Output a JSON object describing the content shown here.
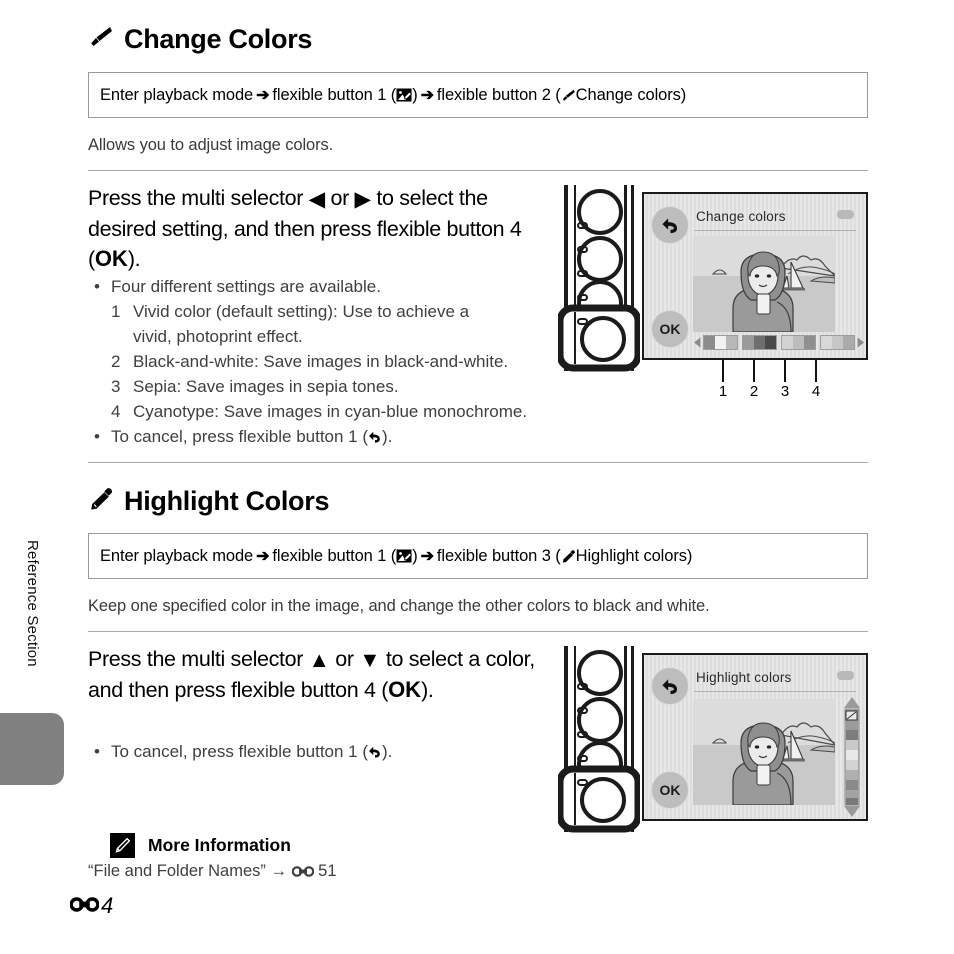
{
  "sidebar": {
    "label": "Reference Section",
    "tab_color": "#808080"
  },
  "sections": [
    {
      "id": "change-colors",
      "icon": "marker-icon",
      "heading": "Change Colors",
      "breadcrumb": {
        "part1": "Enter playback mode",
        "arrow": "➔",
        "part2": "flexible button 1 (",
        "icon1": "edit-image-icon",
        "part3": ")",
        "arrow2": "➔",
        "part4": "flexible button 2 (",
        "icon2": "marker-icon",
        "part5": " Change colors)"
      },
      "lede": "Allows you to adjust image colors.",
      "instruction": {
        "line1_a": "Press the multi selector ",
        "left_tri": "◀",
        "line1_b": " or ",
        "right_tri": "▶",
        "line1_c": " to select",
        "line2": "the desired setting, and then press flexible",
        "line3_a": "button 4 (",
        "ok": "OK",
        "line3_b": ")."
      },
      "bullets": [
        "Four different settings are available.",
        "To cancel, press flexible button 1 ("
      ],
      "numbered": [
        {
          "n": "1",
          "text": "Vivid color (default setting): Use to achieve a"
        },
        {
          "n": "",
          "text": "vivid, photoprint effect."
        },
        {
          "n": "2",
          "text": "Black-and-white: Save images in black-and-white."
        },
        {
          "n": "3",
          "text": "Sepia: Save images in sepia tones."
        },
        {
          "n": "4",
          "text": "Cyanotype: Save images in cyan-blue monochrome."
        }
      ],
      "cancel_suffix": ").",
      "lcd": {
        "title": "Change colors",
        "back_icon": "back-arrow-icon",
        "ok_label": "OK",
        "battery_icon": "battery-icon"
      },
      "callouts": [
        "1",
        "2",
        "3",
        "4"
      ],
      "swatches": [
        [
          "#8c8c8c",
          "#f2f2f2",
          "#b8b8b8"
        ],
        [
          "#9a9a9a",
          "#6e6e6e",
          "#4a4a4a"
        ],
        [
          "#d3d3d3",
          "#bdbdbd",
          "#8f8f8f"
        ],
        [
          "#d8d8d8",
          "#c6c6c6",
          "#ababab"
        ]
      ]
    },
    {
      "id": "highlight-colors",
      "icon": "eyedropper-icon",
      "heading": "Highlight Colors",
      "breadcrumb": {
        "part1": "Enter playback mode",
        "arrow": "➔",
        "part2": "flexible button 1 (",
        "icon1": "edit-image-icon",
        "part3": ")",
        "arrow2": "➔",
        "part4": "flexible button 3 (",
        "icon2": "eyedropper-icon",
        "part5": " Highlight colors)"
      },
      "lede": "Keep one specified color in the image, and change the other colors to black and white.",
      "instruction": {
        "line1_a": "Press the multi selector ",
        "up_tri": "▲",
        "line1_b": " or ",
        "down_tri": "▼",
        "line1_c": " to select a",
        "line2": "color, and then press flexible button 4",
        "line3_a": "(",
        "ok": "OK",
        "line3_b": ")."
      },
      "bullets": [
        "To cancel, press flexible button 1 ("
      ],
      "cancel_suffix": ").",
      "lcd": {
        "title": "Highlight colors",
        "back_icon": "back-arrow-icon",
        "ok_label": "OK",
        "battery_icon": "battery-icon"
      },
      "slider_colors": [
        "#8f8f8f",
        "#9b9b9b",
        "#7d7d7d",
        "#c9c9c9",
        "#e8e8e8",
        "#d2d2d2",
        "#b0b0b0",
        "#8a8a8a",
        "#a3a3a3",
        "#7a7a7a"
      ]
    }
  ],
  "more_info": {
    "badge_icon": "pencil-note-icon",
    "title": "More Information",
    "reference_text": "“File and Folder Names” → ",
    "reference_symbol": "E-symbol",
    "reference_page": "51"
  },
  "footer": {
    "symbol": "E-symbol",
    "page": "4"
  }
}
